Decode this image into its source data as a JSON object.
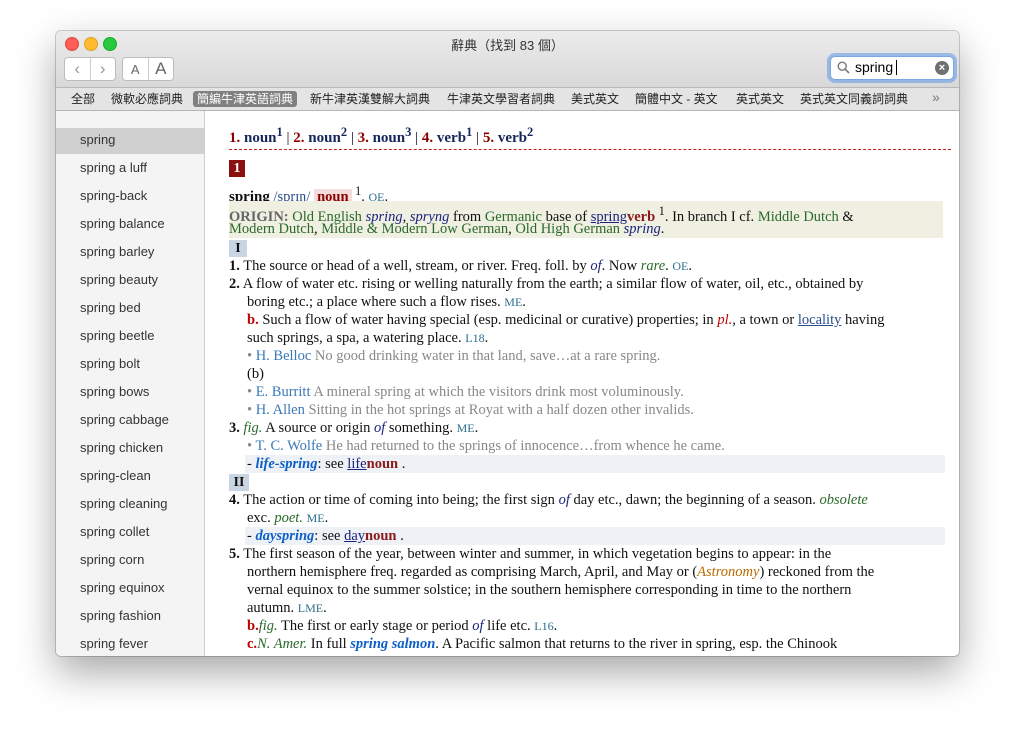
{
  "window": {
    "title": "辭典（找到 83 個）"
  },
  "toolbar": {
    "font_small": "A",
    "font_large": "A",
    "back_icon": "chevron-left-icon",
    "forward_icon": "chevron-right-icon"
  },
  "search": {
    "value": "spring",
    "icon": "magnifier-icon",
    "clear_icon": "clear-icon"
  },
  "tabs": [
    "全部",
    "微軟必應詞典",
    "簡編牛津英語詞典",
    "新牛津英漢雙解大詞典",
    "牛津英文學習者詞典",
    "美式英文",
    "簡體中文 - 英文",
    "英式英文",
    "英式英文同義詞詞典"
  ],
  "tabs_more": "»",
  "sidebar": {
    "items": [
      "spring",
      "spring a luff",
      "spring-back",
      "spring balance",
      "spring barley",
      "spring beauty",
      "spring bed",
      "spring beetle",
      "spring bolt",
      "spring bows",
      "spring cabbage",
      "spring chicken",
      "spring-clean",
      "spring cleaning",
      "spring collet",
      "spring corn",
      "spring equinox",
      "spring fashion",
      "spring fever"
    ]
  },
  "entry": {
    "homographs": {
      "h1_num": "1.",
      "h1_pos": "noun",
      "h1_sup": "1",
      "h2_num": "2.",
      "h2_pos": "noun",
      "h2_sup": "2",
      "h3_num": "3.",
      "h3_pos": "noun",
      "h3_sup": "3",
      "h4_num": "4.",
      "h4_pos": "verb",
      "h4_sup": "1",
      "h5_num": "5.",
      "h5_pos": "verb",
      "h5_sup": "2",
      "sep": "|"
    },
    "badge": "1",
    "headword": "spring",
    "pron": "/sprɪŋ/",
    "pos": "noun",
    "hw_sup": "1",
    "hw_dot": ".",
    "hw_oe": "OE",
    "origin": {
      "label": "ORIGIN:",
      "old_english": "Old English",
      "form1": "spring",
      "comma1": ",",
      "form2": "spryng",
      "from": "from",
      "germanic": "Germanic",
      "base_of": "base of",
      "link_spring": "spring",
      "link_verb": "verb",
      "sup": "1",
      "rest1": ". In branch I cf.",
      "middle_dutch": "Middle Dutch",
      "amp": "&",
      "modern_dutch": "Modern Dutch",
      "comma2": ",",
      "mmlg": "Middle & Modern Low German",
      "comma3": ",",
      "ohg": "Old High German",
      "form3": "spring",
      "end": "."
    },
    "roman1": "I",
    "s1": {
      "num": "1.",
      "text1": "The source or head of a well, stream, or river. Freq. foll. by",
      "of": "of",
      "text2": ". Now",
      "rare": "rare",
      "text3": ".",
      "oe": "OE",
      "end": "."
    },
    "s2": {
      "num": "2.",
      "line1": "A flow of water etc. rising or welling naturally from the earth; a similar flow of water, oil, etc., obtained by",
      "line2": "boring etc.; a place where such a flow rises.",
      "me": "ME",
      "end": "."
    },
    "s2b": {
      "letter": "b.",
      "text1": "Such a flow of water having special (esp. medicinal or curative) properties; in",
      "pl": "pl.",
      "text2": ", a town or",
      "link": "locality",
      "text3": "having",
      "line2": "such springs, a spa, a watering place.",
      "tag": "L18",
      "end": "."
    },
    "q1": {
      "bullet": "•",
      "author": "H. Belloc",
      "text": "No good drinking water in that land, save…at a rare spring."
    },
    "b_paren": "(b)",
    "q2": {
      "bullet": "•",
      "author": "E. Burritt",
      "text": "A mineral spring at which the visitors drink most voluminously."
    },
    "q3": {
      "bullet": "•",
      "author": "H. Allen",
      "text": "Sitting in the hot springs at Royat with a half dozen other invalids."
    },
    "s3": {
      "num": "3.",
      "fig": "fig.",
      "text1": "A source or origin",
      "of": "of",
      "text2": "something.",
      "me": "ME",
      "end": "."
    },
    "q4": {
      "bullet": "•",
      "author": "T. C. Wolfe",
      "text": "He had returned to the springs of innocence…from whence he came."
    },
    "d1": {
      "dash": "-",
      "phrase": "life-spring",
      "see": ": see",
      "link": "life",
      "pos": "noun",
      "end": "."
    },
    "roman2": "II",
    "s4": {
      "num": "4.",
      "text1": "The action or time of coming into being; the first sign",
      "of": "of",
      "text2": "day etc., dawn; the beginning of a season.",
      "obsolete": "obsolete",
      "line2a": "exc.",
      "poet": "poet.",
      "me": "ME",
      "end": "."
    },
    "d2": {
      "dash": "-",
      "phrase": "dayspring",
      "see": ": see",
      "link": "day",
      "pos": "noun",
      "end": "."
    },
    "s5": {
      "num": "5.",
      "line1": "The first season of the year, between winter and summer, in which vegetation begins to appear: in the",
      "line2a": "northern hemisphere freq. regarded as comprising March, April, and May or (",
      "astronomy": "Astronomy",
      "line2b": ") reckoned from the",
      "line3": "vernal equinox to the summer solstice; in the southern hemisphere corresponding in time to the northern",
      "line4": "autumn.",
      "lme": "LME",
      "end": "."
    },
    "s5b": {
      "letter": "b.",
      "fig": "fig.",
      "text1": "The first or early stage or period",
      "of": "of",
      "text2": "life etc.",
      "tag": "L16",
      "end": "."
    },
    "s5c": {
      "letter": "c.",
      "region": "N. Amer.",
      "text1": "In full",
      "phrase": "spring salmon",
      "text2": ". A Pacific salmon that returns to the river in spring, esp. the Chinook"
    }
  }
}
